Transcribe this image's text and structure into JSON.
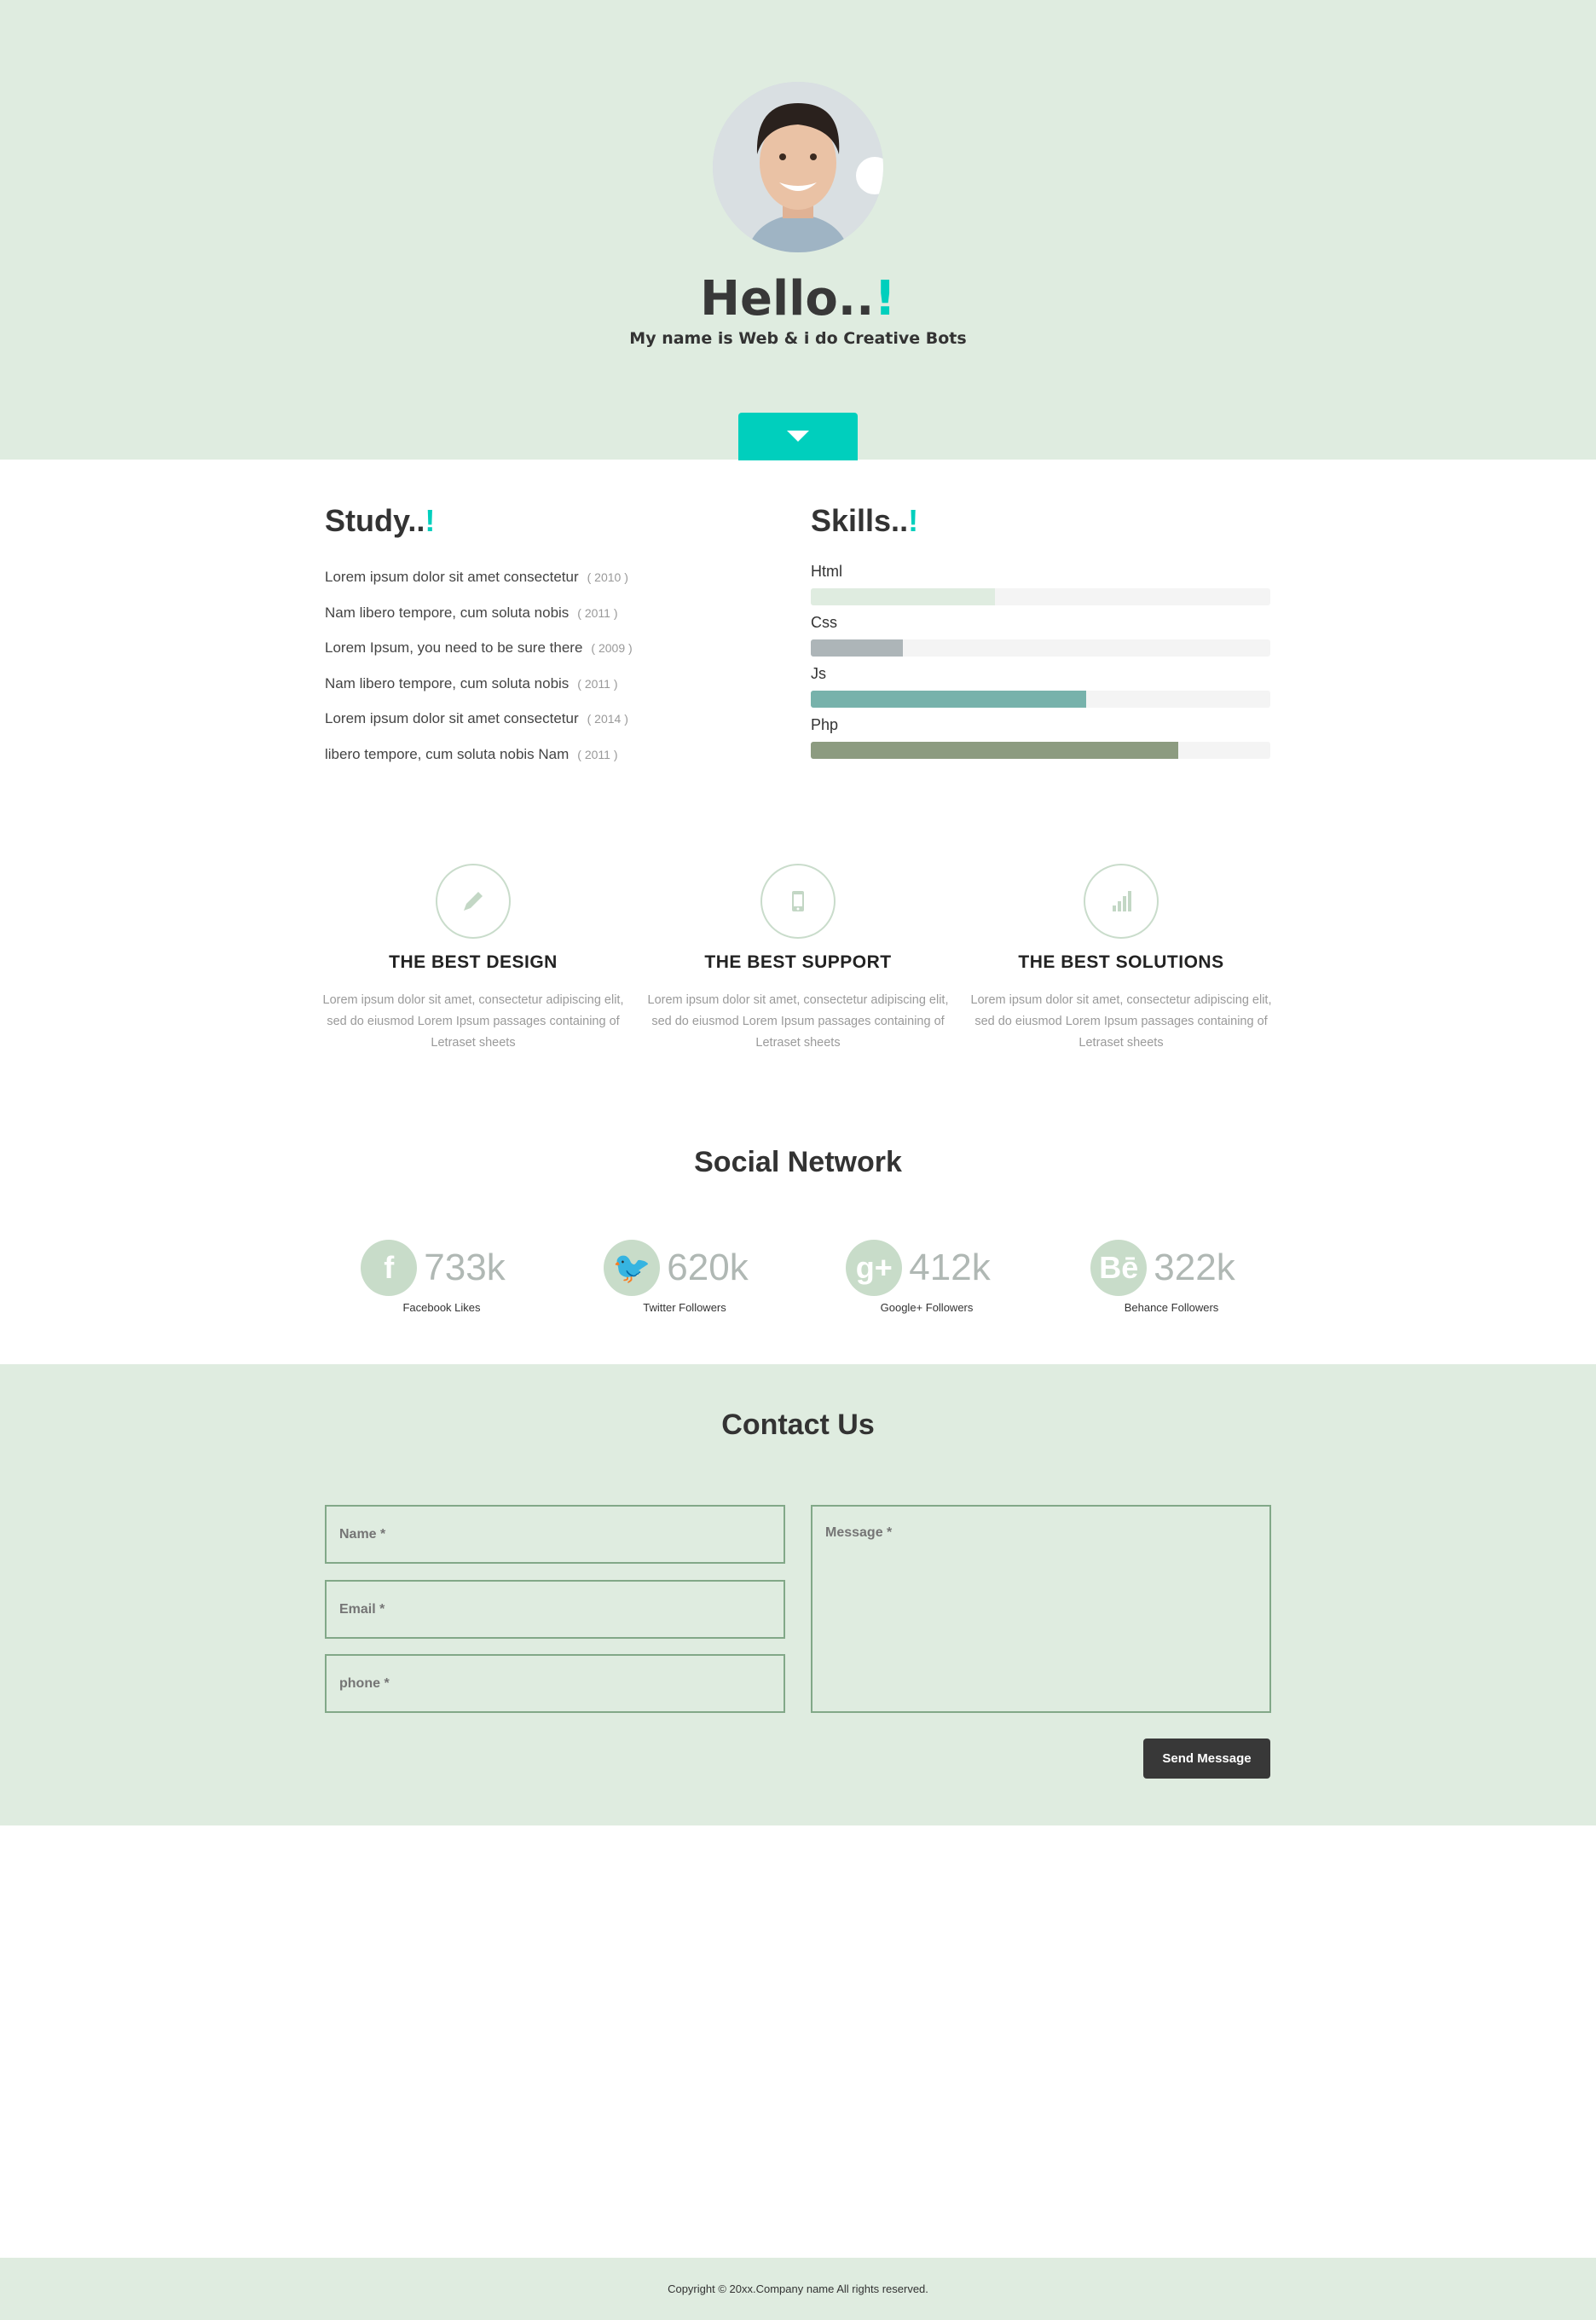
{
  "hero": {
    "title": "Hello..",
    "title_accent": "!",
    "subtitle": "My name is Web & i do Creative Bots"
  },
  "colors": {
    "accent": "#00cfbd",
    "hero_bg": "#dfece0",
    "button_dark": "#383838"
  },
  "study": {
    "heading": "Study..",
    "accent": "!",
    "items": [
      {
        "text": "Lorem ipsum dolor sit amet consectetur",
        "year": "( 2010 )"
      },
      {
        "text": "Nam libero tempore, cum soluta nobis",
        "year": "( 2011 )"
      },
      {
        "text": "Lorem Ipsum, you need to be sure there",
        "year": "( 2009 )"
      },
      {
        "text": "Nam libero tempore, cum soluta nobis",
        "year": "( 2011 )"
      },
      {
        "text": "Lorem ipsum dolor sit amet consectetur",
        "year": "( 2014 )"
      },
      {
        "text": "libero tempore, cum soluta nobis Nam",
        "year": "( 2011 )"
      }
    ]
  },
  "skills": {
    "heading": "Skills..",
    "accent": "!",
    "items": [
      {
        "label": "Html",
        "percent": 40,
        "color": "#dfece0"
      },
      {
        "label": "Css",
        "percent": 20,
        "color": "#adb5b8"
      },
      {
        "label": "Js",
        "percent": 60,
        "color": "#77b2ab"
      },
      {
        "label": "Php",
        "percent": 80,
        "color": "#8c9b80"
      }
    ]
  },
  "features": [
    {
      "icon": "pencil-icon",
      "title": "THE BEST DESIGN",
      "text": "Lorem ipsum dolor sit amet, consectetur adipiscing elit, sed do eiusmod Lorem Ipsum passages containing of Letraset sheets"
    },
    {
      "icon": "mobile-icon",
      "title": "THE BEST SUPPORT",
      "text": "Lorem ipsum dolor sit amet, consectetur adipiscing elit, sed do eiusmod Lorem Ipsum passages containing of Letraset sheets"
    },
    {
      "icon": "signal-bars-icon",
      "title": "THE BEST SOLUTIONS",
      "text": "Lorem ipsum dolor sit amet, consectetur adipiscing elit, sed do eiusmod Lorem Ipsum passages containing of Letraset sheets"
    }
  ],
  "social": {
    "heading": "Social Network",
    "items": [
      {
        "icon": "facebook-icon",
        "glyph": "f",
        "count": "733k",
        "label": "Facebook Likes"
      },
      {
        "icon": "twitter-icon",
        "glyph": "🐦",
        "count": "620k",
        "label": "Twitter Followers"
      },
      {
        "icon": "google-plus-icon",
        "glyph": "g+",
        "count": "412k",
        "label": "Google+ Followers"
      },
      {
        "icon": "behance-icon",
        "glyph": "Bē",
        "count": "322k",
        "label": "Behance Followers"
      }
    ]
  },
  "contact": {
    "heading": "Contact Us",
    "name_placeholder": "Name *",
    "email_placeholder": "Email *",
    "phone_placeholder": "phone *",
    "message_placeholder": "Message *",
    "send_label": "Send Message"
  },
  "footer": {
    "copyright": "Copyright © 20xx.Company name All rights reserved."
  }
}
